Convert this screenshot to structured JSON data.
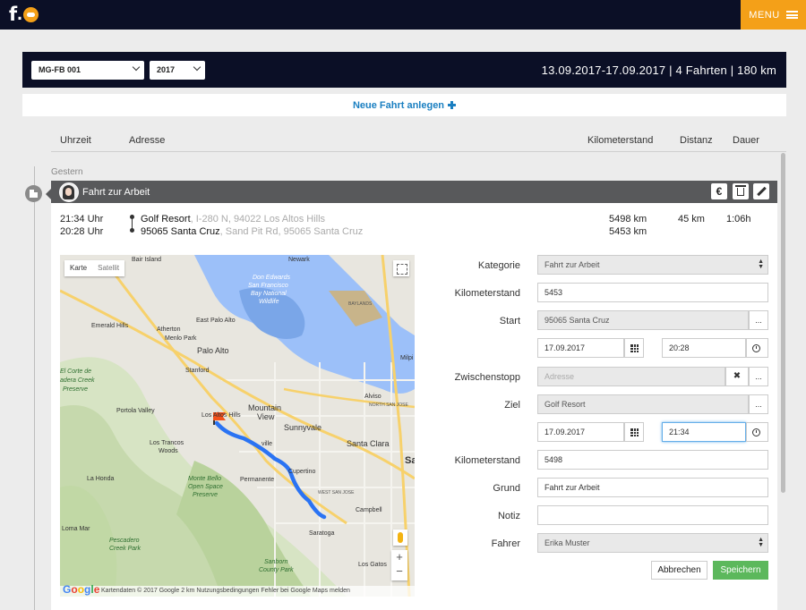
{
  "header": {
    "logo_letter": "f",
    "logo_dot": ".",
    "menu_label": "MENU"
  },
  "filters": {
    "vehicle": "MG-FB 001",
    "year": "2017",
    "summary": "13.09.2017-17.09.2017 | 4 Fahrten | 180 km"
  },
  "new_trip_label": "Neue Fahrt anlegen",
  "columns": {
    "time": "Uhrzeit",
    "address": "Adresse",
    "odometer": "Kilometerstand",
    "distance": "Distanz",
    "duration": "Dauer"
  },
  "day_label": "Gestern",
  "trip": {
    "title": "Fahrt zur Arbeit",
    "actions": {
      "expense": "€"
    },
    "end_time": "21:34 Uhr",
    "start_time": "20:28 Uhr",
    "end_place": "Golf Resort",
    "end_address": ", I-280 N, 94022 Los Altos Hills",
    "start_place": "95065 Santa Cruz",
    "start_address": ", Sand Pit Rd, 95065 Santa Cruz",
    "end_km": "5498 km",
    "start_km": "5453 km",
    "distance": "45 km",
    "duration": "1:06h"
  },
  "map": {
    "tab_map": "Karte",
    "tab_satellite": "Satellit",
    "zoom_in": "+",
    "zoom_out": "−",
    "google": "Google",
    "footer": "Kartendaten © 2017 Google    2 km         Nutzungsbedingungen    Fehler bei Google Maps melden",
    "labels": {
      "bair_island": "Bair Island",
      "newark": "Newark",
      "don_edwards": "Don Edwards",
      "san_francisco": "San Francisco",
      "bay_national": "Bay National",
      "wildlife": "Wildlife",
      "emerald_hills": "Emerald Hills",
      "atherton": "Atherton",
      "menlo_park": "Menlo Park",
      "east_palo_alto": "East Palo Alto",
      "palo_alto": "Palo Alto",
      "stanford": "Stanford",
      "corte": "El Corte de",
      "madera": "adera Creek",
      "preserve": "Preserve",
      "portola_valley": "Portola Valley",
      "los_altos_hills": "Los Altos Hills",
      "mountain_view": "Mountain",
      "view": "View",
      "sunnyvale": "Sunnyvale",
      "santa_clara": "Santa Clara",
      "los_trancos": "Los Trancos",
      "woods": "Woods",
      "cupertino": "Cupertino",
      "la_honda": "La Honda",
      "monte_bello": "Monte Bello",
      "open_space": "Open Space",
      "preserve2": "Preserve",
      "permanente": "Permanente",
      "campbell": "Campbell",
      "saratoga": "Saratoga",
      "loma_mar": "Loma Mar",
      "pescadero": "Pescadero",
      "creek_park": "Creek Park",
      "sanborn": "Sanborn",
      "county_park": "County Park",
      "los_gatos": "Los Gatos",
      "milpitas": "Milpi",
      "alviso": "Alviso",
      "north_san_jose": "NORTH SAN JOSE",
      "west_san_jose": "WEST SAN JOSE",
      "baylands": "BAYLANDS",
      "sa": "Sa",
      "ville": "ville"
    }
  },
  "form": {
    "category_label": "Kategorie",
    "category_value": "Fahrt zur Arbeit",
    "km_start_label": "Kilometerstand",
    "km_start_value": "5453",
    "start_label": "Start",
    "start_value": "95065 Santa Cruz",
    "start_date": "17.09.2017",
    "start_time": "20:28",
    "stop_label": "Zwischenstopp",
    "stop_placeholder": "Adresse",
    "dest_label": "Ziel",
    "dest_value": "Golf Resort",
    "dest_date": "17.09.2017",
    "dest_time": "21:34",
    "km_end_label": "Kilometerstand",
    "km_end_value": "5498",
    "reason_label": "Grund",
    "reason_value": "Fahrt zur Arbeit",
    "note_label": "Notiz",
    "note_value": "",
    "driver_label": "Fahrer",
    "driver_value": "Erika Muster",
    "more": "...",
    "clear": "✖",
    "cancel_label": "Abbrechen",
    "save_label": "Speichern"
  }
}
